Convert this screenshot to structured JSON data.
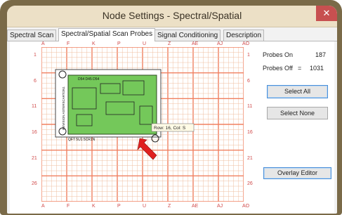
{
  "window": {
    "title": "Node Settings - Spectral/Spatial",
    "close_glyph": "✕"
  },
  "tabs": [
    {
      "label": "Spectral Scan",
      "active": false
    },
    {
      "label": "Spectral/Spatial Scan Probes",
      "active": true
    },
    {
      "label": "Signal Conditioning",
      "active": false
    },
    {
      "label": "Description",
      "active": false
    }
  ],
  "grid": {
    "col_labels": [
      "A",
      "F",
      "K",
      "P",
      "U",
      "Z",
      "AE",
      "AJ",
      "AO"
    ],
    "row_labels": [
      "1",
      "6",
      "11",
      "16",
      "21",
      "26"
    ],
    "tooltip": "Row: 16,  Col: S",
    "board_text_top": "D54 D45   D54",
    "board_text_left": "PCR GROUND",
    "board_text_bottom": "QFT 5U1 5CR1N",
    "board_side_text": "REVISION ASTERSCARTON1"
  },
  "probes": {
    "on_label": "Probes On",
    "on_value": "187",
    "off_label": "Probes Off",
    "off_eq": "=",
    "off_value": "1031"
  },
  "buttons": {
    "select_all": "Select All",
    "select_none": "Select None",
    "overlay_editor": "Overlay Editor"
  },
  "colors": {
    "grid_line": "#efbfa0",
    "grid_major": "#f08060",
    "board": "#74c85a",
    "label_red": "#d04848",
    "arrow": "#e02020"
  }
}
